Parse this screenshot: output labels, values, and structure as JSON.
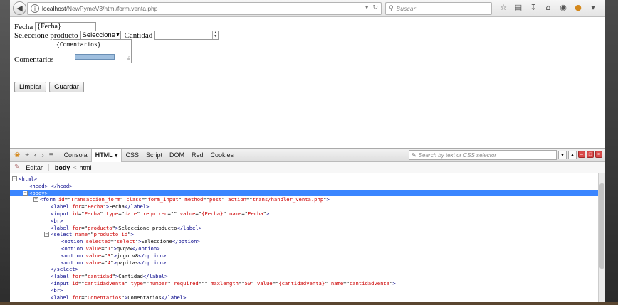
{
  "browser": {
    "url_host": "localhost",
    "url_path": "/NewPymeV3/html/form.venta.php",
    "search_placeholder": "Buscar"
  },
  "form": {
    "fecha_label": "Fecha",
    "fecha_value": "{Fecha}",
    "producto_label": "Seleccione producto",
    "producto_selected": "Seleccione",
    "cantidad_label": "Cantidad",
    "comentarios_label": "Comentarios",
    "comentarios_value": "{Comentarios}",
    "limpiar_label": "Limpiar",
    "guardar_label": "Guardar"
  },
  "devtools": {
    "tabs": [
      "Consola",
      "HTML",
      "CSS",
      "Script",
      "DOM",
      "Red",
      "Cookies"
    ],
    "active_tab": "HTML",
    "search_placeholder": "Search by text or CSS selector",
    "edit_label": "Editar",
    "breadcrumb": [
      "body",
      "html"
    ],
    "code": [
      {
        "indent": 0,
        "toggle": "-",
        "html": "<span class=\"tg\">&lt;html&gt;</span>"
      },
      {
        "indent": 1,
        "toggle": "",
        "html": "<span class=\"tg\">&lt;head&gt; &lt;/head&gt;</span>"
      },
      {
        "indent": 1,
        "toggle": "-",
        "sel": true,
        "html": "<span class=\"tg\">&lt;body&gt;</span>"
      },
      {
        "indent": 2,
        "toggle": "-",
        "html": "<span class=\"tg\">&lt;form</span> <span class=\"at\">id</span>=\"<span class=\"av\">Transaccion_form</span>\" <span class=\"at\">class</span>=\"<span class=\"av\">form_input</span>\" <span class=\"at\">method</span>=\"<span class=\"av\">post</span>\" <span class=\"at\">action</span>=\"<span class=\"av\">trans/handler_venta.php</span>\"<span class=\"tg\">&gt;</span>"
      },
      {
        "indent": 3,
        "toggle": "",
        "html": "<span class=\"tg\">&lt;label</span> <span class=\"at\">for</span>=\"<span class=\"av\">Fecha</span>\"<span class=\"tg\">&gt;</span>Fecha<span class=\"tg\">&lt;/label&gt;</span>"
      },
      {
        "indent": 3,
        "toggle": "",
        "html": "<span class=\"tg\">&lt;input</span> <span class=\"at\">id</span>=\"<span class=\"av\">Fecha</span>\" <span class=\"at\">type</span>=\"<span class=\"av\">date</span>\" <span class=\"at\">required</span>=\"\" <span class=\"at\">value</span>=\"<span class=\"av\">{Fecha}</span>\" <span class=\"at\">name</span>=\"<span class=\"av\">Fecha</span>\"<span class=\"tg\">&gt;</span>"
      },
      {
        "indent": 3,
        "toggle": "",
        "html": "<span class=\"tg\">&lt;br&gt;</span>"
      },
      {
        "indent": 3,
        "toggle": "",
        "html": "<span class=\"tg\">&lt;label</span> <span class=\"at\">for</span>=\"<span class=\"av\">producto</span>\"<span class=\"tg\">&gt;</span>Seleccione producto<span class=\"tg\">&lt;/label&gt;</span>"
      },
      {
        "indent": 3,
        "toggle": "-",
        "html": "<span class=\"tg\">&lt;select</span> <span class=\"at\">name</span>=\"<span class=\"av\">producto_id</span>\"<span class=\"tg\">&gt;</span>"
      },
      {
        "indent": 4,
        "toggle": "",
        "html": "<span class=\"tg\">&lt;option</span> <span class=\"at\">selected</span>=\"<span class=\"av\">select</span>\"<span class=\"tg\">&gt;</span>Seleccione<span class=\"tg\">&lt;/option&gt;</span>"
      },
      {
        "indent": 4,
        "toggle": "",
        "html": "<span class=\"tg\">&lt;option</span> <span class=\"at\">value</span>=\"<span class=\"av\">1</span>\"<span class=\"tg\">&gt;</span>qvqvw<span class=\"tg\">&lt;/option&gt;</span>"
      },
      {
        "indent": 4,
        "toggle": "",
        "html": "<span class=\"tg\">&lt;option</span> <span class=\"at\">value</span>=\"<span class=\"av\">3</span>\"<span class=\"tg\">&gt;</span>jugo v8<span class=\"tg\">&lt;/option&gt;</span>"
      },
      {
        "indent": 4,
        "toggle": "",
        "html": "<span class=\"tg\">&lt;option</span> <span class=\"at\">value</span>=\"<span class=\"av\">4</span>\"<span class=\"tg\">&gt;</span>papitas<span class=\"tg\">&lt;/option&gt;</span>"
      },
      {
        "indent": 3,
        "toggle": "",
        "html": "<span class=\"tg\">&lt;/select&gt;</span>"
      },
      {
        "indent": 3,
        "toggle": "",
        "html": "<span class=\"tg\">&lt;label</span> <span class=\"at\">for</span>=\"<span class=\"av\">cantidad</span>\"<span class=\"tg\">&gt;</span>Cantidad<span class=\"tg\">&lt;/label&gt;</span>"
      },
      {
        "indent": 3,
        "toggle": "",
        "html": "<span class=\"tg\">&lt;input</span> <span class=\"at\">id</span>=\"<span class=\"av\">cantidadventa</span>\" <span class=\"at\">type</span>=\"<span class=\"av\">number</span>\" <span class=\"at\">required</span>=\"\" <span class=\"at\">maxlength</span>=\"<span class=\"av\">50</span>\" <span class=\"at\">value</span>=\"<span class=\"av\">{cantidadventa}</span>\" <span class=\"at\">name</span>=\"<span class=\"av\">cantidadventa</span>\"<span class=\"tg\">&gt;</span>"
      },
      {
        "indent": 3,
        "toggle": "",
        "html": "<span class=\"tg\">&lt;br&gt;</span>"
      },
      {
        "indent": 3,
        "toggle": "",
        "html": "<span class=\"tg\">&lt;label</span> <span class=\"at\">for</span>=\"<span class=\"av\">Comentarios</span>\"<span class=\"tg\">&gt;</span>Comentarios<span class=\"tg\">&lt;/label&gt;</span>"
      }
    ]
  }
}
